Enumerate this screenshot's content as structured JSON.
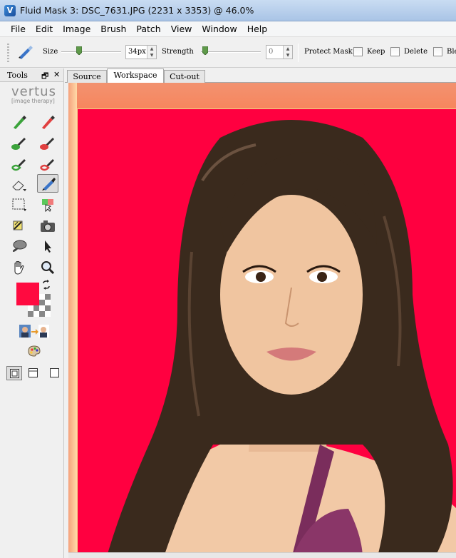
{
  "window": {
    "title": "Fluid Mask 3: DSC_7631.JPG (2231 x 3353) @ 46.0%"
  },
  "menu": [
    "File",
    "Edit",
    "Image",
    "Brush",
    "Patch",
    "View",
    "Window",
    "Help"
  ],
  "toolbar": {
    "size_label": "Size",
    "size_value": "34px",
    "strength_label": "Strength",
    "strength_value": "0",
    "protect_label": "Protect Mask:",
    "keep_label": "Keep",
    "delete_label": "Delete",
    "blend_label": "Ble"
  },
  "tools_panel": {
    "title": "Tools",
    "float_glyph": "🗗",
    "close_glyph": "✕",
    "logo_word": "vertus",
    "logo_sub": "[image therapy]"
  },
  "tabs": [
    "Source",
    "Workspace",
    "Cut-out"
  ],
  "active_tab": "Workspace",
  "colors": {
    "foreground": "#ff0a40",
    "canvas_bg": "#ff0040",
    "accent": "#6aa0dc"
  },
  "icons": {
    "tools": [
      "pencil-green-icon",
      "pencil-red-icon",
      "brush-green-icon",
      "brush-red-icon",
      "lasso-brush-green-icon",
      "lasso-brush-red-icon",
      "eraser-icon",
      "patch-brush-icon",
      "rectangle-select-icon",
      "color-pick-icon",
      "local-mask-icon",
      "camera-icon",
      "blob-icon",
      "arrow-pointer-icon",
      "hand-icon",
      "zoom-icon"
    ]
  }
}
